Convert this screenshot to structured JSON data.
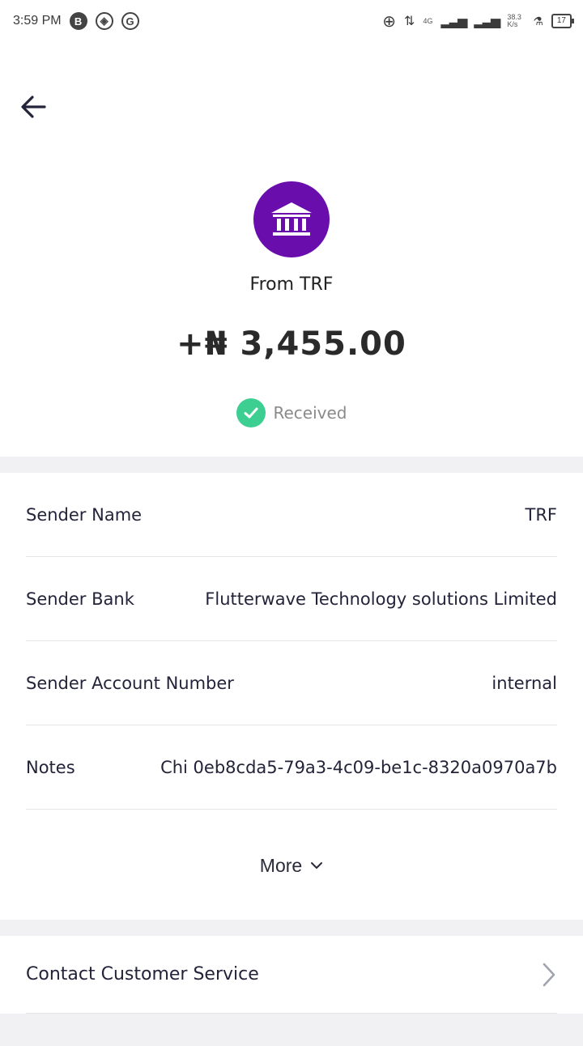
{
  "status_bar": {
    "time": "3:59 PM",
    "network": "4G",
    "speed": "38.3 K/s",
    "battery": "17"
  },
  "transaction": {
    "from_label": "From TRF",
    "amount": "+₦ 3,455.00",
    "status": "Received",
    "status_color": "#3ccf91",
    "bank_icon_color": "#6a0dad"
  },
  "details": {
    "rows": [
      {
        "label": "Sender Name",
        "value": "TRF"
      },
      {
        "label": "Sender Bank",
        "value": "Flutterwave Technology solutions Limited"
      },
      {
        "label": "Sender Account Number",
        "value": "internal"
      },
      {
        "label": "Notes",
        "value": "Chi 0eb8cda5-79a3-4c09-be1c-8320a0970a7b"
      }
    ],
    "more_label": "More"
  },
  "contact": {
    "label": "Contact Customer Service"
  }
}
